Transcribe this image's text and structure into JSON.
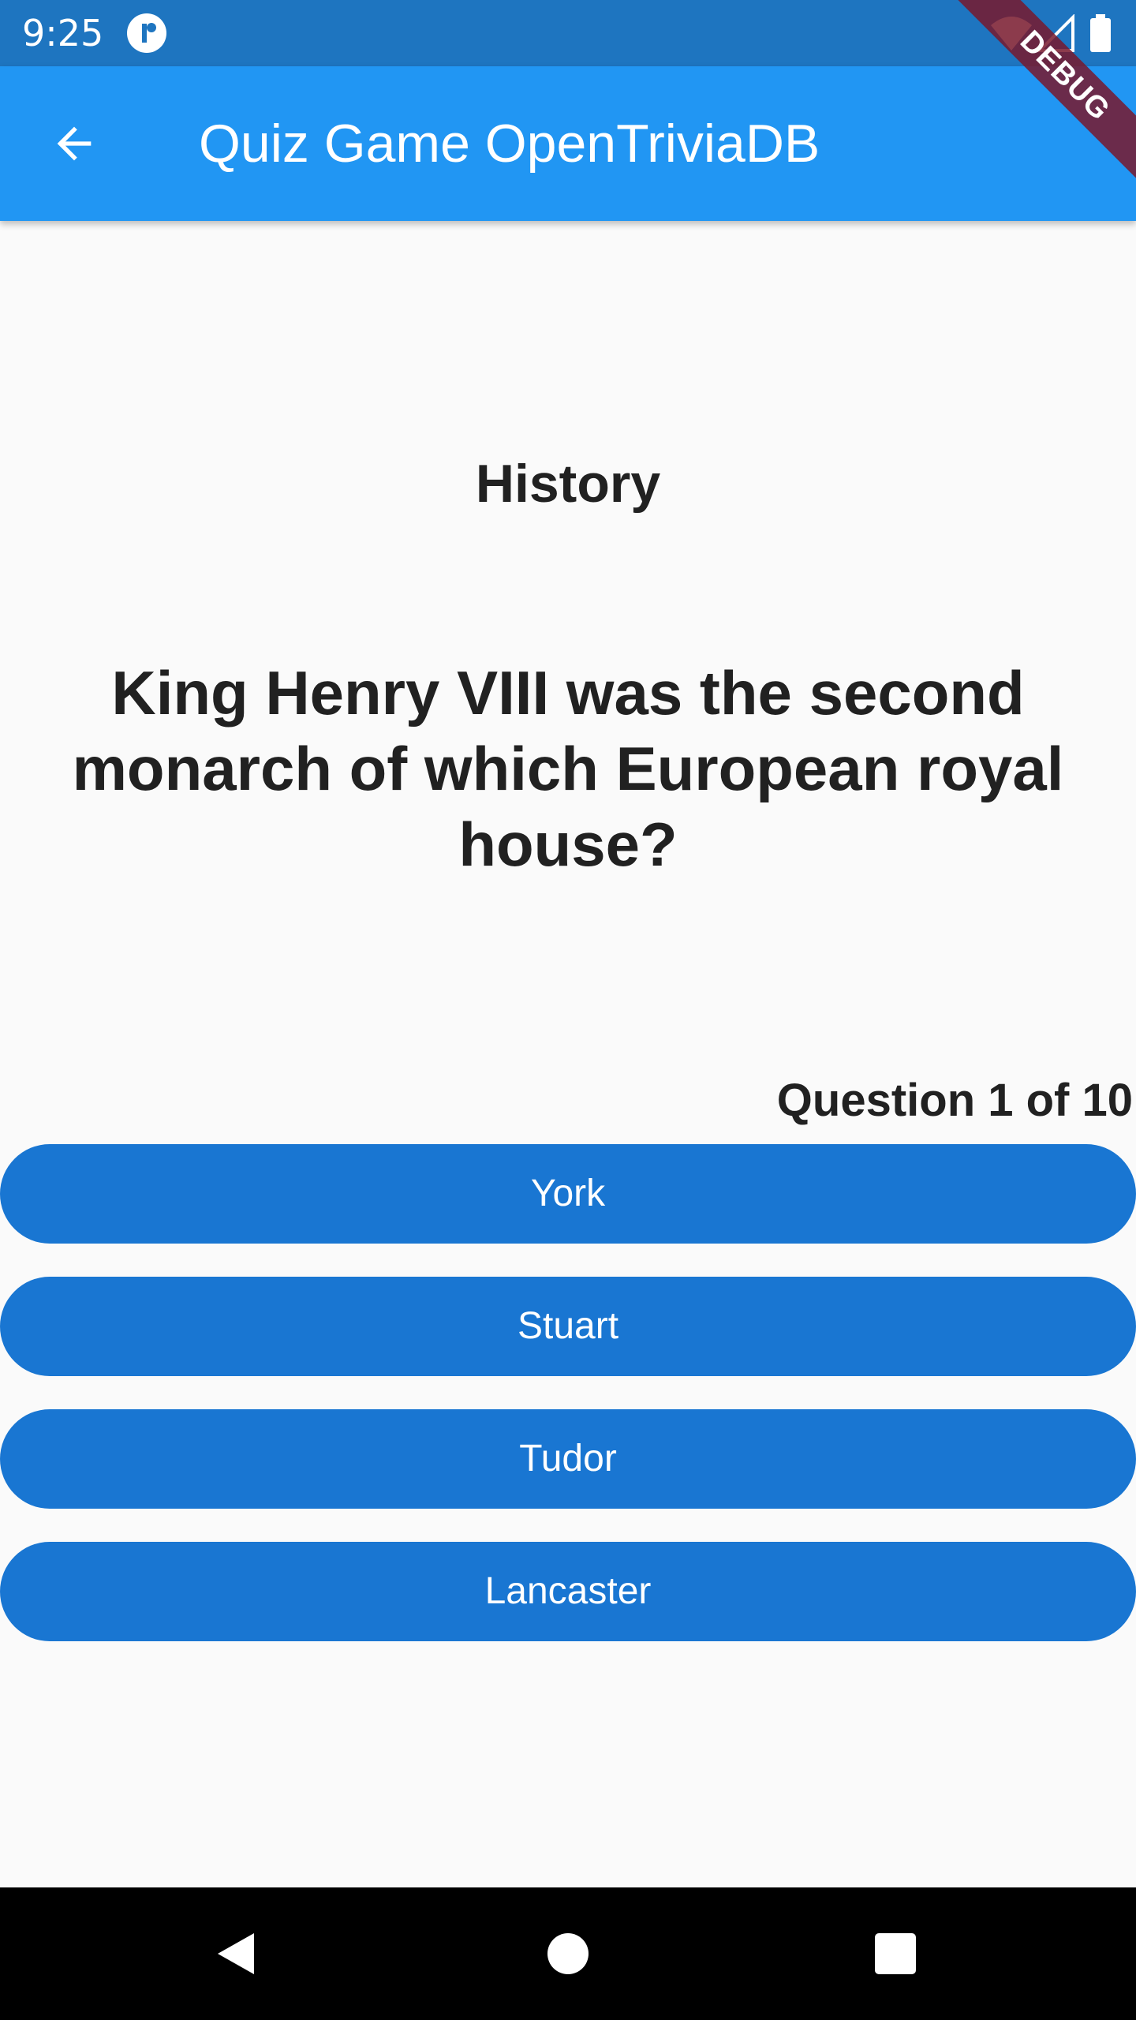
{
  "status_bar": {
    "time": "9:25",
    "icons": [
      "app-notification-icon",
      "wifi-icon",
      "signal-icon",
      "battery-icon"
    ]
  },
  "app_bar": {
    "title": "Quiz Game OpenTriviaDB",
    "back_icon": "arrow-back-icon",
    "color": "#2196f3"
  },
  "debug_banner": {
    "label": "DEBUG"
  },
  "quiz": {
    "category": "History",
    "question": "King Henry VIII was the second monarch of which European royal house?",
    "counter": "Question 1 of 10",
    "answers": [
      {
        "label": "York"
      },
      {
        "label": "Stuart"
      },
      {
        "label": "Tudor"
      },
      {
        "label": "Lancaster"
      }
    ],
    "answer_color": "#1976d2"
  },
  "nav_bar": {
    "buttons": [
      "back-triangle-icon",
      "home-circle-icon",
      "recents-square-icon"
    ]
  }
}
